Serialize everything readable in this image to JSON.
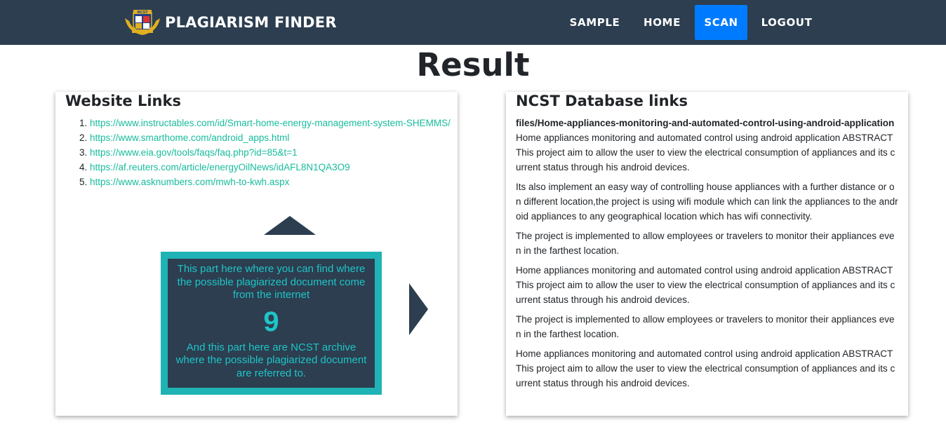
{
  "navbar": {
    "brand": "PLAGIARISM FINDER",
    "logo_text": "NCST",
    "items": [
      {
        "label": "SAMPLE",
        "active": false
      },
      {
        "label": "HOME",
        "active": false
      },
      {
        "label": "SCAN",
        "active": true
      },
      {
        "label": "LOGOUT",
        "active": false
      }
    ],
    "active_color": "#007bff",
    "bg_color": "#2c3e50"
  },
  "page": {
    "title": "Result"
  },
  "website_links": {
    "heading": "Website Links",
    "links": [
      "https://www.instructables.com/id/Smart-home-energy-management-system-SHEMMS/",
      "https://www.smarthome.com/android_apps.html",
      "https://www.eia.gov/tools/faqs/faq.php?id=85&t=1",
      "https://af.reuters.com/article/energyOilNews/idAFL8N1QA3O9",
      "https://www.asknumbers.com/mwh-to-kwh.aspx"
    ],
    "info_box": {
      "top_text": "This part here where you can find where the possible plagiarized document come from the internet",
      "number": "9",
      "bottom_text": "And this part here are NCST archive where the possible plagiarized document are referred to."
    }
  },
  "ncst_links": {
    "heading": "NCST Database links",
    "file": "files/Home-appliances-monitoring-and-automated-control-using-android-application",
    "paragraphs": [
      "Home appliances monitoring and automated control using android application ABSTRACT This project aim to allow the user to view the electrical consumption of appliances and its current status through his android devices.",
      "Its also implement an easy way of controlling house appliances with a further distance or on different location,the project is using wifi module which can link the appliances to the android appliances to any geographical location which has wifi connectivity.",
      "The project is implemented to allow employees or travelers to monitor their appliances even in the farthest location.",
      "Home appliances monitoring and automated control using android application ABSTRACT This project aim to allow the user to view the electrical consumption of appliances and its current status through his android devices.",
      "The project is implemented to allow employees or travelers to monitor their appliances even in the farthest location.",
      "Home appliances monitoring and automated control using android application ABSTRACT This project aim to allow the user to view the electrical consumption of appliances and its current status through his android devices."
    ]
  }
}
